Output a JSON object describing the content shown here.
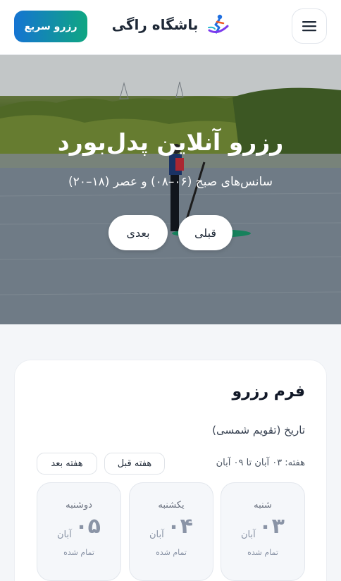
{
  "header": {
    "brand": "باشگاه راگی",
    "quick_reserve": "رزرو سریع"
  },
  "hero": {
    "title": "رزرو آنلاین پدل‌بورد",
    "subtitle": "سانس‌های صبح (۰۶–۰۸) و عصر (۱۸–۲۰)",
    "prev_label": "قبلی",
    "next_label": "بعدی"
  },
  "form": {
    "title": "فرم رزرو",
    "date_label": "تاریخ (تقویم شمسی)",
    "week_text": "هفته: ۰۳ آبان تا ۰۹ آبان",
    "prev_week": "هفته قبل",
    "next_week": "هفته بعد",
    "days": [
      {
        "name": "شنبه",
        "num": "۰۳",
        "month": "آبان",
        "status": "تمام شده"
      },
      {
        "name": "یکشنبه",
        "num": "۰۴",
        "month": "آبان",
        "status": "تمام شده"
      },
      {
        "name": "دوشنبه",
        "num": "۰۵",
        "month": "آبان",
        "status": "تمام شده"
      }
    ]
  },
  "colors": {
    "accent_start": "#1574d2",
    "accent_end": "#0fa682",
    "day_text": "#8a94a6"
  },
  "icons": {
    "menu": "hamburger-icon",
    "logo": "surfer-logo-icon"
  }
}
